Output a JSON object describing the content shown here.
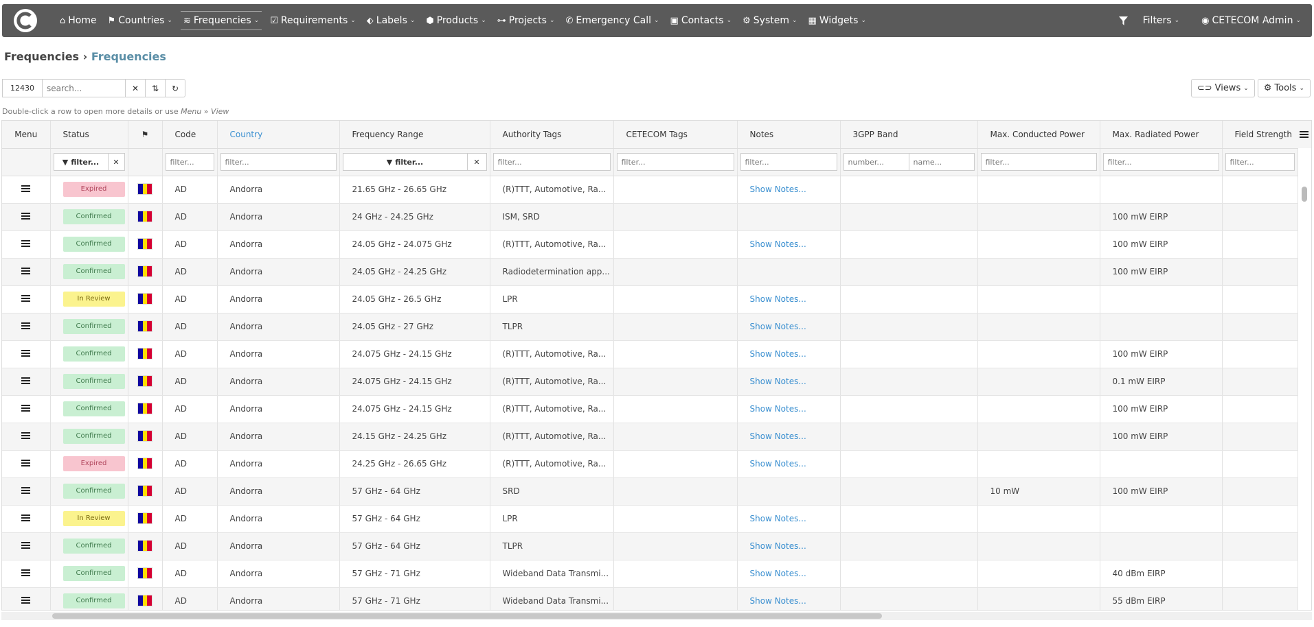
{
  "nav": {
    "items": [
      {
        "label": "Home",
        "icon": "home-icon",
        "glyph": "⌂",
        "caret": false
      },
      {
        "label": "Countries",
        "icon": "flag-icon",
        "glyph": "⚑",
        "caret": true
      },
      {
        "label": "Frequencies",
        "icon": "wifi-icon",
        "glyph": "≋",
        "caret": true,
        "active": true
      },
      {
        "label": "Requirements",
        "icon": "calendar-check-icon",
        "glyph": "☑",
        "caret": true
      },
      {
        "label": "Labels",
        "icon": "tags-icon",
        "glyph": "⬖",
        "caret": true
      },
      {
        "label": "Products",
        "icon": "cube-icon",
        "glyph": "⬢",
        "caret": true
      },
      {
        "label": "Projects",
        "icon": "sitemap-icon",
        "glyph": "⊶",
        "caret": true
      },
      {
        "label": "Emergency Call",
        "icon": "phone-icon",
        "glyph": "✆",
        "caret": true
      },
      {
        "label": "Contacts",
        "icon": "address-card-icon",
        "glyph": "▣",
        "caret": true
      },
      {
        "label": "System",
        "icon": "cogs-icon",
        "glyph": "⚙",
        "caret": true
      },
      {
        "label": "Widgets",
        "icon": "th-large-icon",
        "glyph": "▦",
        "caret": true
      }
    ],
    "filters_label": "Filters",
    "user_label": "CETECOM Admin"
  },
  "breadcrumb": {
    "parent": "Frequencies",
    "current": "Frequencies",
    "separator": "›"
  },
  "toolbar": {
    "count": "12430",
    "search_placeholder": "search...",
    "views_label": "Views",
    "tools_label": "Tools"
  },
  "hint": {
    "text": "Double-click a row to open more details or use ",
    "menu": "Menu",
    "sep": " » ",
    "view": "View"
  },
  "columns": [
    "Menu",
    "Status",
    "",
    "Code",
    "Country",
    "Frequency Range",
    "Authority Tags",
    "CETECOM Tags",
    "Notes",
    "3GPP Band",
    "Max. Conducted Power",
    "Max. Radiated Power",
    "Field Strength"
  ],
  "filters": {
    "status": "filter...",
    "code": "filter...",
    "country": "filter...",
    "range": "filter...",
    "authority": "filter...",
    "cetecom": "filter...",
    "notes": "filter...",
    "band_number": "number...",
    "band_name": "name...",
    "conducted": "filter...",
    "radiated": "filter...",
    "field": "filter..."
  },
  "flag_colors": [
    "#10069f",
    "#fedd00",
    "#d50032"
  ],
  "status_colors": {
    "Expired": "#f8c5cf",
    "Confirmed": "#c9efd2",
    "In Review": "#fbf38e"
  },
  "rows": [
    {
      "status": "Expired",
      "code": "AD",
      "country": "Andorra",
      "range": "21.65 GHz - 26.65 GHz",
      "authority": "(R)TTT, Automotive, Ra...",
      "cetecom": "",
      "notes": "Show Notes...",
      "band": "",
      "conducted": "",
      "radiated": "",
      "field": ""
    },
    {
      "status": "Confirmed",
      "code": "AD",
      "country": "Andorra",
      "range": "24 GHz - 24.25 GHz",
      "authority": "ISM, SRD",
      "cetecom": "",
      "notes": "",
      "band": "",
      "conducted": "",
      "radiated": "100 mW EIRP",
      "field": ""
    },
    {
      "status": "Confirmed",
      "code": "AD",
      "country": "Andorra",
      "range": "24.05 GHz - 24.075 GHz",
      "authority": "(R)TTT, Automotive, Ra...",
      "cetecom": "",
      "notes": "Show Notes...",
      "band": "",
      "conducted": "",
      "radiated": "100 mW EIRP",
      "field": ""
    },
    {
      "status": "Confirmed",
      "code": "AD",
      "country": "Andorra",
      "range": "24.05 GHz - 24.25 GHz",
      "authority": "Radiodetermination app...",
      "cetecom": "",
      "notes": "",
      "band": "",
      "conducted": "",
      "radiated": "100 mW EIRP",
      "field": ""
    },
    {
      "status": "In Review",
      "code": "AD",
      "country": "Andorra",
      "range": "24.05 GHz - 26.5 GHz",
      "authority": "LPR",
      "cetecom": "",
      "notes": "Show Notes...",
      "band": "",
      "conducted": "",
      "radiated": "",
      "field": ""
    },
    {
      "status": "Confirmed",
      "code": "AD",
      "country": "Andorra",
      "range": "24.05 GHz - 27 GHz",
      "authority": "TLPR",
      "cetecom": "",
      "notes": "Show Notes...",
      "band": "",
      "conducted": "",
      "radiated": "",
      "field": ""
    },
    {
      "status": "Confirmed",
      "code": "AD",
      "country": "Andorra",
      "range": "24.075 GHz - 24.15 GHz",
      "authority": "(R)TTT, Automotive, Ra...",
      "cetecom": "",
      "notes": "Show Notes...",
      "band": "",
      "conducted": "",
      "radiated": "100 mW EIRP",
      "field": ""
    },
    {
      "status": "Confirmed",
      "code": "AD",
      "country": "Andorra",
      "range": "24.075 GHz - 24.15 GHz",
      "authority": "(R)TTT, Automotive, Ra...",
      "cetecom": "",
      "notes": "Show Notes...",
      "band": "",
      "conducted": "",
      "radiated": "0.1 mW EIRP",
      "field": ""
    },
    {
      "status": "Confirmed",
      "code": "AD",
      "country": "Andorra",
      "range": "24.075 GHz - 24.15 GHz",
      "authority": "(R)TTT, Automotive, Ra...",
      "cetecom": "",
      "notes": "Show Notes...",
      "band": "",
      "conducted": "",
      "radiated": "100 mW EIRP",
      "field": ""
    },
    {
      "status": "Confirmed",
      "code": "AD",
      "country": "Andorra",
      "range": "24.15 GHz - 24.25 GHz",
      "authority": "(R)TTT, Automotive, Ra...",
      "cetecom": "",
      "notes": "Show Notes...",
      "band": "",
      "conducted": "",
      "radiated": "100 mW EIRP",
      "field": ""
    },
    {
      "status": "Expired",
      "code": "AD",
      "country": "Andorra",
      "range": "24.25 GHz - 26.65 GHz",
      "authority": "(R)TTT, Automotive, Ra...",
      "cetecom": "",
      "notes": "Show Notes...",
      "band": "",
      "conducted": "",
      "radiated": "",
      "field": ""
    },
    {
      "status": "Confirmed",
      "code": "AD",
      "country": "Andorra",
      "range": "57 GHz - 64 GHz",
      "authority": "SRD",
      "cetecom": "",
      "notes": "",
      "band": "",
      "conducted": "10 mW",
      "radiated": "100 mW EIRP",
      "field": ""
    },
    {
      "status": "In Review",
      "code": "AD",
      "country": "Andorra",
      "range": "57 GHz - 64 GHz",
      "authority": "LPR",
      "cetecom": "",
      "notes": "Show Notes...",
      "band": "",
      "conducted": "",
      "radiated": "",
      "field": ""
    },
    {
      "status": "Confirmed",
      "code": "AD",
      "country": "Andorra",
      "range": "57 GHz - 64 GHz",
      "authority": "TLPR",
      "cetecom": "",
      "notes": "Show Notes...",
      "band": "",
      "conducted": "",
      "radiated": "",
      "field": ""
    },
    {
      "status": "Confirmed",
      "code": "AD",
      "country": "Andorra",
      "range": "57 GHz - 71 GHz",
      "authority": "Wideband Data Transmi...",
      "cetecom": "",
      "notes": "Show Notes...",
      "band": "",
      "conducted": "",
      "radiated": "40 dBm EIRP",
      "field": ""
    },
    {
      "status": "Confirmed",
      "code": "AD",
      "country": "Andorra",
      "range": "57 GHz - 71 GHz",
      "authority": "Wideband Data Transmi...",
      "cetecom": "",
      "notes": "Show Notes...",
      "band": "",
      "conducted": "",
      "radiated": "55 dBm EIRP",
      "field": ""
    }
  ]
}
